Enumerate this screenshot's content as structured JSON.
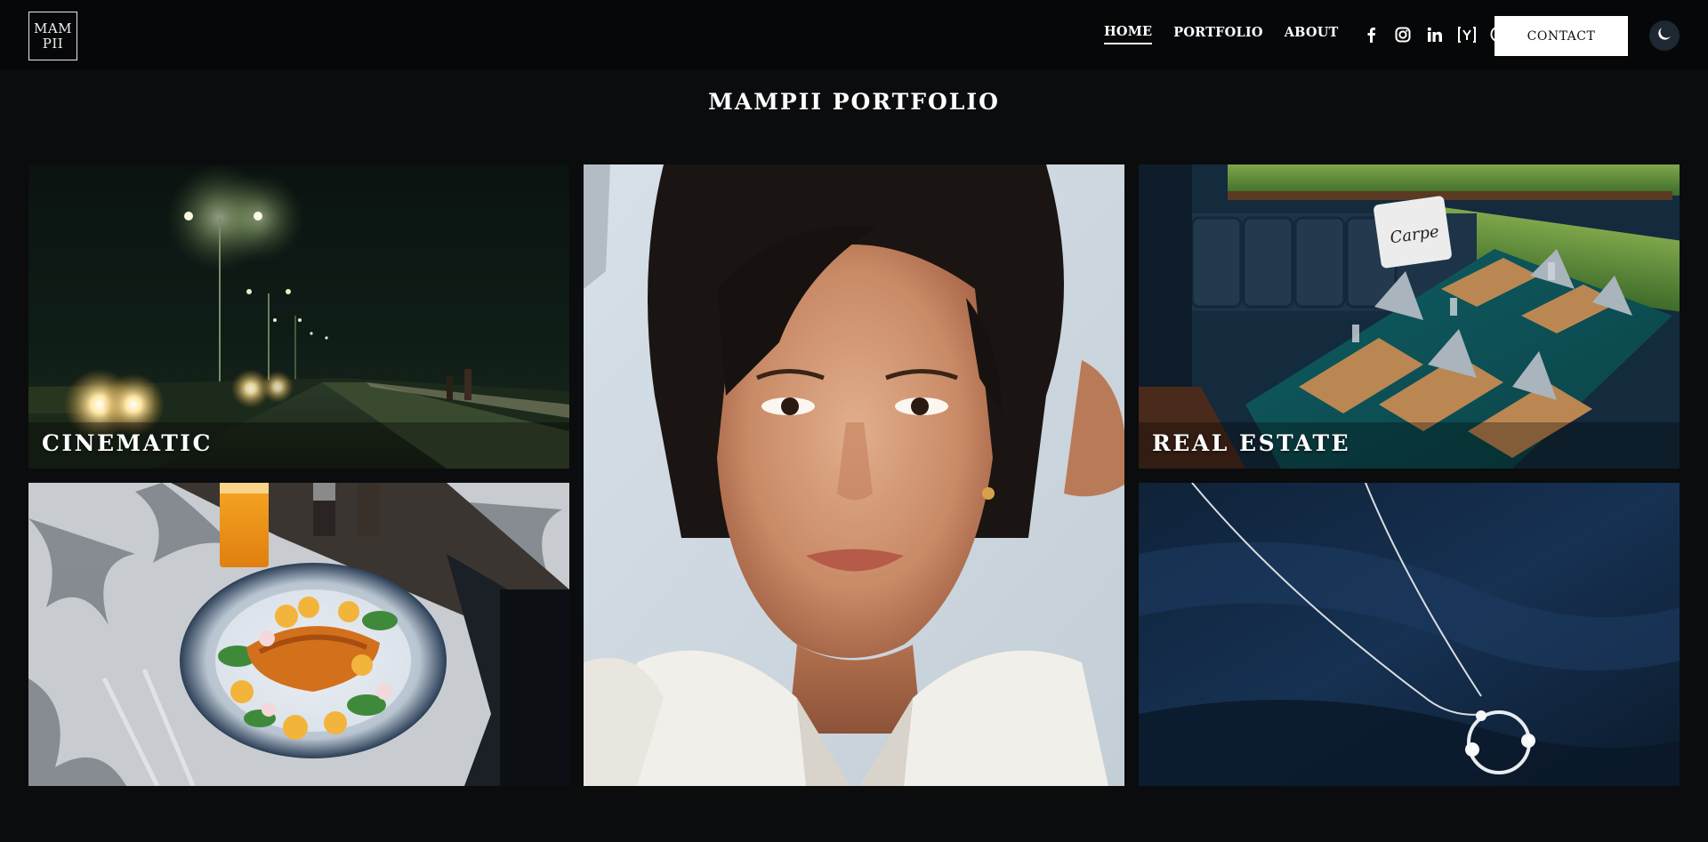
{
  "header": {
    "logo_text": "MAM\nPII",
    "nav": [
      {
        "label": "HOME",
        "active": true
      },
      {
        "label": "PORTFOLIO",
        "active": false
      },
      {
        "label": "ABOUT",
        "active": false
      }
    ],
    "social_icons": [
      "facebook-icon",
      "instagram-icon",
      "linkedin-icon",
      "vimeo-bracket-icon",
      "email-at-icon"
    ],
    "contact_label": "CONTACT",
    "theme_icon": "moon-icon"
  },
  "main": {
    "title": "MAMPII PORTFOLIO",
    "tiles": [
      {
        "name": "cinematic",
        "label": "CINEMATIC",
        "scene": "night street with streetlights and car headlights"
      },
      {
        "name": "portrait",
        "label": "",
        "scene": "portrait of a young woman"
      },
      {
        "name": "real-estate",
        "label": "REAL ESTATE",
        "scene": "restaurant booth with teal table and napkins"
      },
      {
        "name": "food",
        "label": "",
        "scene": "plated food with orange juice"
      },
      {
        "name": "jewelry",
        "label": "",
        "scene": "silver necklace on dark blue fabric"
      }
    ]
  },
  "colors": {
    "background": "#0b0c0e",
    "header": "#060708",
    "button_bg": "#ffffff",
    "toggle_bg": "#1e2832"
  }
}
